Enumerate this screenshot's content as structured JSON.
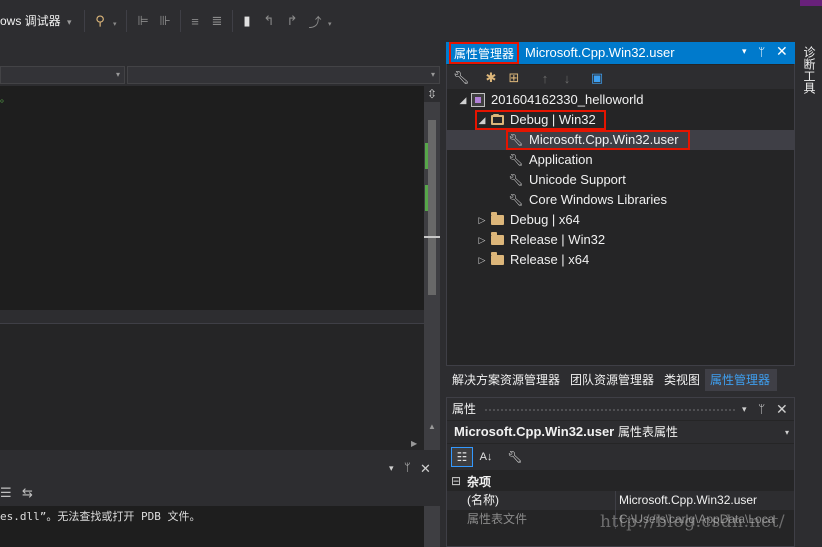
{
  "toolbar": {
    "debugger_label": "ows 调试器",
    "debugger_arrow": "▾",
    "icons": [
      "find-icon",
      "align-left-icon",
      "align-right-icon",
      "comment-icon",
      "bookmark-icon",
      "bookmark-prev-icon",
      "bookmark-next-icon",
      "bookmark-clear-icon"
    ]
  },
  "editor": {
    "line_dot": "。",
    "split_glyph": "⇳"
  },
  "output": {
    "line": "es.dll”。无法查找或打开 PDB 文件。",
    "drop": "▾",
    "pin": "ᛘ",
    "close": "✕"
  },
  "property_manager": {
    "title": "属性管理器",
    "subtitle": "Microsoft.Cpp.Win32.user",
    "drop": "▾",
    "pin": "ᛘ",
    "close": "✕",
    "tree": [
      {
        "label": "201604162330_helloworld",
        "expander": "◢",
        "icon": "project-icon",
        "level": 0
      },
      {
        "label": "Debug | Win32",
        "expander": "◢",
        "icon": "folder-open-icon",
        "level": 1,
        "highlight": true
      },
      {
        "label": "Microsoft.Cpp.Win32.user",
        "expander": "",
        "icon": "wrench-icon",
        "level": 2,
        "selected": true,
        "highlight": true
      },
      {
        "label": "Application",
        "expander": "",
        "icon": "wrench-icon",
        "level": 2
      },
      {
        "label": "Unicode Support",
        "expander": "",
        "icon": "wrench-icon",
        "level": 2
      },
      {
        "label": "Core Windows Libraries",
        "expander": "",
        "icon": "wrench-icon",
        "level": 2
      },
      {
        "label": "Debug | x64",
        "expander": "▷",
        "icon": "folder-icon",
        "level": 1
      },
      {
        "label": "Release | Win32",
        "expander": "▷",
        "icon": "folder-icon",
        "level": 1
      },
      {
        "label": "Release | x64",
        "expander": "▷",
        "icon": "folder-icon",
        "level": 1
      }
    ]
  },
  "tabs": [
    {
      "label": "解决方案资源管理器",
      "active": false
    },
    {
      "label": "团队资源管理器",
      "active": false
    },
    {
      "label": "类视图",
      "active": false
    },
    {
      "label": "属性管理器",
      "active": true
    }
  ],
  "properties": {
    "title": "属性",
    "object_name": "Microsoft.Cpp.Win32.user",
    "object_type": "属性表属性",
    "category_toggle": "⊟",
    "category": "杂项",
    "rows": [
      {
        "name": "(名称)",
        "value": "Microsoft.Cpp.Win32.user",
        "dim": false
      },
      {
        "name": "属性表文件",
        "value": "C:\\Users\\carlq\\AppData\\Loca",
        "dim": true
      }
    ]
  },
  "side_tab": {
    "label": "诊断工具"
  },
  "watermark": "http://blog.csdn.net/",
  "colors": {
    "accent": "#007acc",
    "highlight_box": "#e51400",
    "active_tab_text": "#3e9ff0",
    "folder": "#dcb67a"
  }
}
